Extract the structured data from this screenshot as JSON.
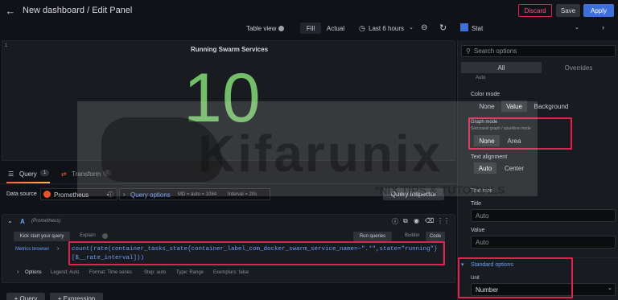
{
  "header": {
    "title": "New dashboard / Edit Panel",
    "discard_label": "Discard",
    "save_label": "Save",
    "apply_label": "Apply"
  },
  "panel_toolbar": {
    "table_view_label": "Table view",
    "fill_label": "Fill",
    "actual_label": "Actual",
    "time_range_label": "Last 6 hours",
    "visualization_label": "Stat"
  },
  "panel": {
    "number": "1",
    "title": "Running Swarm Services",
    "value": "10",
    "value_color": "#73bf69"
  },
  "query_tabs": {
    "query_label": "Query",
    "query_count": "1",
    "transform_label": "Transform",
    "transform_count": "0"
  },
  "datasource": {
    "label": "Data source",
    "name": "Prometheus",
    "query_options_label": "Query options",
    "query_options_meta": "MD = auto = 1084",
    "interval_meta": "Interval = 20s",
    "query_inspector_label": "Query inspector"
  },
  "query": {
    "ref": "A",
    "datasource_tag": "(Prometheus)",
    "kickstart_label": "Kick start your query",
    "explain_label": "Explain",
    "run_label": "Run queries",
    "builder_label": "Builder",
    "code_label": "Code",
    "metrics_browser_label": "Metrics browser",
    "expr_line1": "count(rate(container_tasks_state{container_label_com_docker_swarm_service_name=~\".*\",state=\"running\"}",
    "expr_line2": "[$__rate_interval]))",
    "options_label": "Options",
    "options_legend": "Legend: Auto",
    "options_format": "Format: Time series",
    "options_step": "Step: auto",
    "options_type": "Type: Range",
    "options_exemplars": "Exemplars: false"
  },
  "bottom_buttons": {
    "add_query": "+ Query",
    "add_expression": "+ Expression"
  },
  "options_pane": {
    "search_placeholder": "Search options",
    "tab_all": "All",
    "tab_overrides": "Overrides",
    "top_cut_text": "Auto",
    "color_mode_label": "Color mode",
    "color_mode_none": "None",
    "color_mode_value": "Value",
    "color_mode_background": "Background",
    "graph_mode_label": "Graph mode",
    "graph_mode_desc": "Stat panel graph / sparkline mode",
    "graph_mode_none": "None",
    "graph_mode_area": "Area",
    "text_alignment_label": "Text alignment",
    "text_alignment_auto": "Auto",
    "text_alignment_center": "Center",
    "text_size_label": "Text size",
    "title_label": "Title",
    "title_placeholder": "Auto",
    "value_label": "Value",
    "value_placeholder": "Auto",
    "standard_options_label": "Standard options",
    "unit_label": "Unit",
    "unit_value": "Number"
  },
  "watermark": {
    "brand": "Kifarunix",
    "tagline": "*NIX TIPS & TUTORIALS"
  },
  "colors": {
    "accent_blue": "#3d71d9",
    "discard_red": "#e0224f",
    "stat_green": "#73bf69"
  }
}
